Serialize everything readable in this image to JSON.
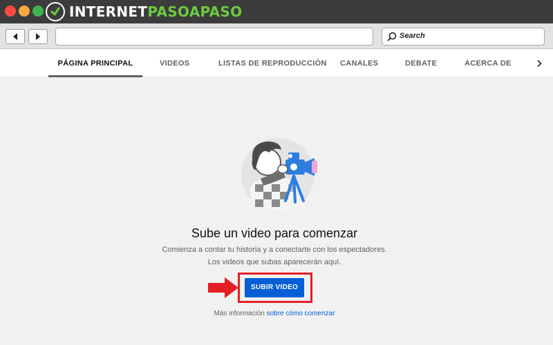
{
  "window": {
    "brand_prefix": "INTERNET",
    "brand_accent": "PASOAPASO",
    "brand_accent_color": "#6ccb3e"
  },
  "browser": {
    "search_placeholder": "Search",
    "url_value": ""
  },
  "tabs": [
    {
      "label": "PÁGINA PRINCIPAL",
      "active": true
    },
    {
      "label": "VIDEOS",
      "active": false
    },
    {
      "label": "LISTAS DE REPRODUCCIÓN",
      "active": false
    },
    {
      "label": "CANALES",
      "active": false
    },
    {
      "label": "DEBATE",
      "active": false
    },
    {
      "label": "ACERCA DE",
      "active": false
    }
  ],
  "empty_state": {
    "title": "Sube un video para comenzar",
    "description": "Comienza a contar tu historia y a conectarte con los espectadores. Los videos que subas aparecerán aquí.",
    "upload_button": "SUBIR VIDEO",
    "more_info_text": "Más información",
    "more_info_link": "sobre cómo comenzar"
  },
  "colors": {
    "primary_button": "#065fd4",
    "highlight": "#e31e24"
  },
  "icons": [
    "back-arrow-icon",
    "forward-arrow-icon",
    "search-icon",
    "chevron-right-icon",
    "red-arrow-icon"
  ]
}
